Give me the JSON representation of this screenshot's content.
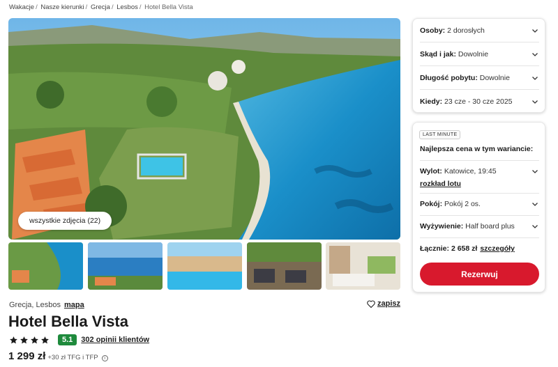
{
  "breadcrumb": [
    "Wakacje",
    "Nasze kierunki",
    "Grecja",
    "Lesbos",
    "Hotel Bella Vista"
  ],
  "gallery": {
    "all_photos_label": "wszystkie zdjęcia (22)"
  },
  "hotel": {
    "location": "Grecja, Lesbos",
    "map_label": "mapa",
    "save_label": "zapisz",
    "name": "Hotel Bella Vista",
    "stars": 4,
    "score": "5.1",
    "reviews_label": "302 opinii klientów",
    "price": "1 299 zł",
    "price_extra": "+30 zł TFG i TFP"
  },
  "filters": {
    "persons": {
      "label": "Osoby:",
      "value": "2 dorosłych"
    },
    "from": {
      "label": "Skąd i jak:",
      "value": "Dowolnie"
    },
    "duration": {
      "label": "Długość pobytu:",
      "value": "Dowolnie"
    },
    "when": {
      "label": "Kiedy:",
      "value": "23 cze - 30 cze 2025"
    }
  },
  "offer": {
    "badge": "LAST MINUTE",
    "best_price": "Najlepsza cena w tym wariancie:",
    "departure": {
      "label": "Wylot:",
      "value": "Katowice, 19:45"
    },
    "schedule_link": "rozkład lotu",
    "room": {
      "label": "Pokój:",
      "value": "Pokój 2 os."
    },
    "board": {
      "label": "Wyżywienie:",
      "value": "Half board plus"
    },
    "total_label": "Łącznie:",
    "total_value": "2 658 zł",
    "details_link": "szczegóły",
    "reserve_label": "Rezerwuj"
  },
  "colors": {
    "accent": "#d8192d",
    "score_bg": "#1e8a3c",
    "sea": "#1a8fc9"
  }
}
